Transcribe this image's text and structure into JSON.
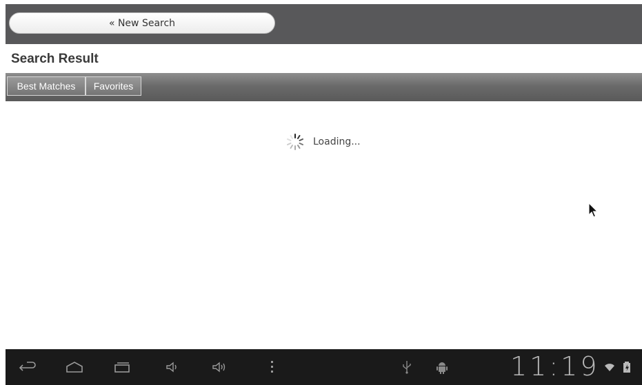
{
  "app": {
    "new_search_label": "« New Search",
    "title": "Search Result"
  },
  "tabs": [
    {
      "label": "Best Matches"
    },
    {
      "label": "Favorites"
    }
  ],
  "content": {
    "loading_text": "Loading..."
  },
  "system_bar": {
    "clock": "11:19"
  },
  "icons": {
    "back": "back-icon",
    "home": "home-icon",
    "recents": "recents-icon",
    "volume_down": "volume-down-icon",
    "volume_up": "volume-up-icon",
    "menu": "overflow-menu-icon",
    "usb": "usb-icon",
    "android_debug": "android-debug-icon",
    "wifi": "wifi-icon",
    "battery": "battery-icon",
    "spinner": "spinner-icon",
    "cursor": "mouse-cursor-icon"
  },
  "colors": {
    "header_bg": "#58585a",
    "tab_bar_bg": "#6a6a6a",
    "nav_bar_bg": "#1a1a1a",
    "clock": "#b9b9b9"
  }
}
